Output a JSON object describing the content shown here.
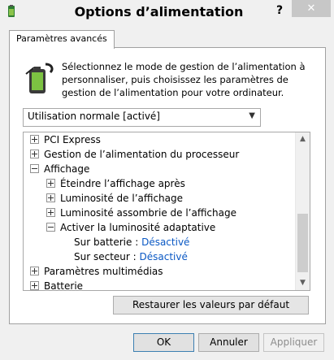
{
  "window": {
    "title": "Options d’alimentation",
    "help_label": "?",
    "close_label": "✕"
  },
  "tabs": [
    {
      "label": "Paramètres avancés"
    }
  ],
  "description": "Sélectionnez le mode de gestion de l’alimentation à personnaliser, puis choisissez les paramètres de gestion de l’alimentation pour votre ordinateur.",
  "plan_select": {
    "selected": "Utilisation normale [activé]"
  },
  "tree": {
    "items": [
      {
        "label": "PCI Express",
        "expander": "plus"
      },
      {
        "label": "Gestion de l’alimentation du processeur",
        "expander": "plus"
      },
      {
        "label": "Affichage",
        "expander": "minus"
      },
      {
        "label": "Éteindre l’affichage après",
        "expander": "plus"
      },
      {
        "label": "Luminosité de l’affichage",
        "expander": "plus"
      },
      {
        "label": "Luminosité assombrie de l’affichage",
        "expander": "plus"
      },
      {
        "label": "Activer la luminosité adaptative",
        "expander": "minus"
      },
      {
        "label": "Sur batterie :",
        "value": "Désactivé"
      },
      {
        "label": "Sur secteur :",
        "value": "Désactivé"
      },
      {
        "label": "Paramètres multimédias",
        "expander": "plus"
      },
      {
        "label": "Batterie",
        "expander": "plus"
      }
    ]
  },
  "buttons": {
    "restore": "Restaurer les valeurs par défaut",
    "ok": "OK",
    "cancel": "Annuler",
    "apply": "Appliquer"
  },
  "colors": {
    "link_value": "#0a58c4",
    "close_bg": "#c7c7c7"
  }
}
